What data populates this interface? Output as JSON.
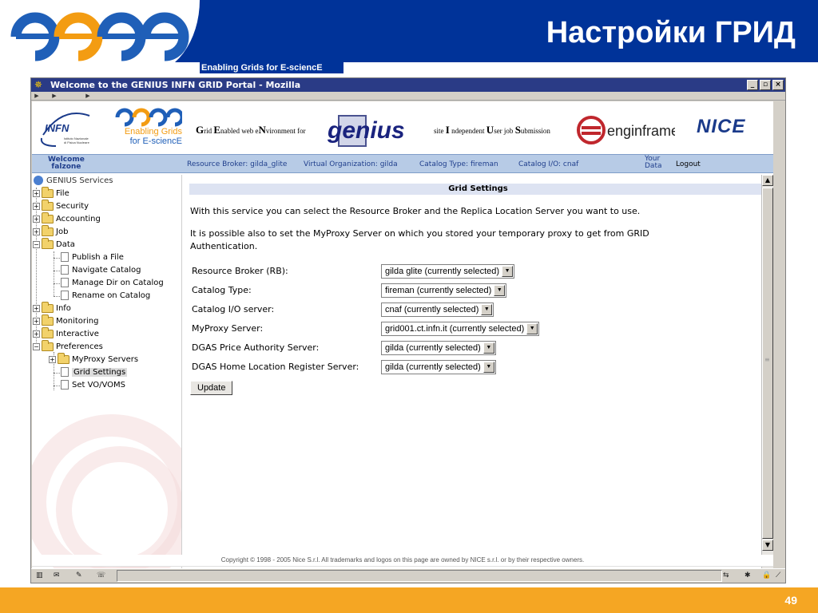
{
  "slide": {
    "title": "Настройки ГРИД",
    "tagline": "Enabling Grids for E-sciencE",
    "page_number": "49"
  },
  "browser": {
    "window_title": "Welcome to the GENIUS INFN GRID Portal - Mozilla"
  },
  "banner": {
    "infn_text": "INFN",
    "infn_sub": "Istituto Nazionale di Fisica Nucleare",
    "egee_tag_line1": "Enabling Grids",
    "egee_tag_line2": "for E-sciencE",
    "genius_text": "genius",
    "enginframe_text": "enginframe",
    "nice_text": "NICE"
  },
  "infobar": {
    "welcome_line1": "Welcome",
    "welcome_line2": "falzone",
    "resource_broker": "Resource Broker: gilda_glite",
    "virtual_org": "Virtual Organization: gilda",
    "catalog_type": "Catalog Type: fireman",
    "catalog_io": "Catalog I/O: cnaf",
    "your_data_line1": "Your",
    "your_data_line2": "Data",
    "logout": "Logout"
  },
  "sidebar": {
    "root": "GENIUS Services",
    "items": {
      "file": "File",
      "security": "Security",
      "accounting": "Accounting",
      "job": "Job",
      "data": "Data",
      "publish_file": "Publish a File",
      "navigate_catalog": "Navigate Catalog",
      "manage_dir": "Manage Dir on Catalog",
      "rename_catalog": "Rename on Catalog",
      "info": "Info",
      "monitoring": "Monitoring",
      "interactive": "Interactive",
      "preferences": "Preferences",
      "myproxy_servers": "MyProxy Servers",
      "grid_settings": "Grid Settings",
      "set_vo": "Set VO/VOMS"
    }
  },
  "main": {
    "section_title": "Grid Settings",
    "intro": "With this service you can select the Resource Broker and the Replica Location Server you want to use.",
    "intro2_line1": "It is possible also to set the MyProxy Server on which you stored your temporary proxy to get from GRID",
    "intro2_line2": "Authentication.",
    "fields": {
      "rb_label": "Resource Broker (RB):",
      "rb_value": "gilda glite (currently selected)",
      "ct_label": "Catalog Type:",
      "ct_value": "fireman (currently selected)",
      "cio_label": "Catalog I/O server:",
      "cio_value": "cnaf (currently selected)",
      "mp_label": "MyProxy Server:",
      "mp_value": "grid001.ct.infn.it (currently selected)",
      "dpa_label": "DGAS Price Authority Server:",
      "dpa_value": "gilda (currently selected)",
      "dhl_label": "DGAS Home Location Register Server:",
      "dhl_value": "gilda (currently selected)"
    },
    "update_label": "Update"
  },
  "footer": {
    "copyright": "Copyright © 1998 - 2005 Nice S.r.l. All trademarks and logos on this page are owned by NICE s.r.l. or by their respective owners."
  },
  "colors": {
    "slide_blue": "#003399",
    "slide_orange": "#f5a623",
    "infobar_bg": "#b7cbe6",
    "section_title_bg": "#dde3f2"
  }
}
